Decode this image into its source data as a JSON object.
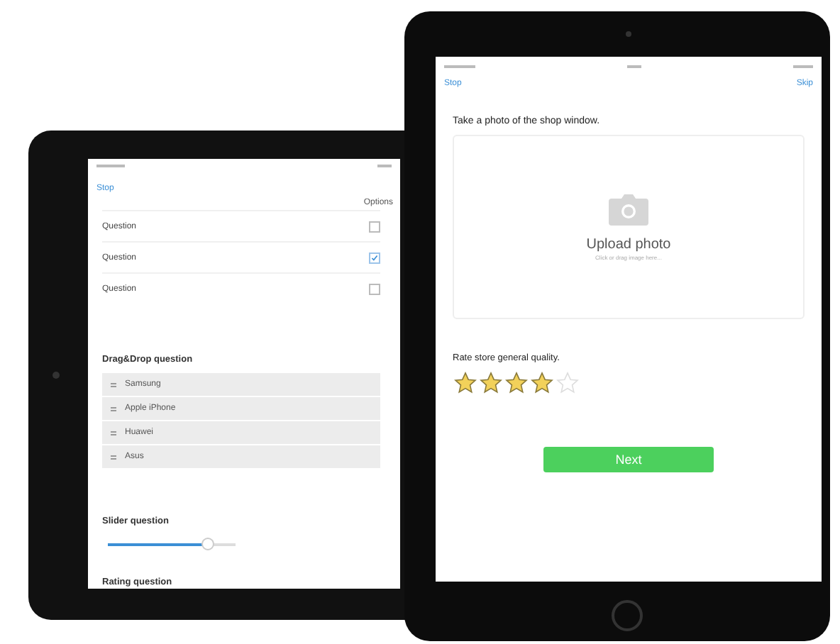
{
  "left_tablet": {
    "nav": {
      "back": "Stop"
    },
    "options_header": "Options",
    "questions": [
      {
        "label": "Question",
        "checked": false
      },
      {
        "label": "Question",
        "checked": true
      },
      {
        "label": "Question",
        "checked": false
      }
    ],
    "drag_drop": {
      "title": "Drag&Drop question",
      "items": [
        "Samsung",
        "Apple iPhone",
        "Huawei",
        "Asus"
      ]
    },
    "slider": {
      "title": "Slider question",
      "level": 0.78
    },
    "rating": {
      "title": "Rating question"
    }
  },
  "right_tablet": {
    "nav": {
      "back": "Stop",
      "forward": "Skip"
    },
    "photo_prompt": "Take a photo of the shop window.",
    "upload": {
      "label": "Upload photo",
      "hint": "Click or drag image here..."
    },
    "rating": {
      "title": "Rate store general quality.",
      "stars": 4
    },
    "next_button": "Next"
  }
}
